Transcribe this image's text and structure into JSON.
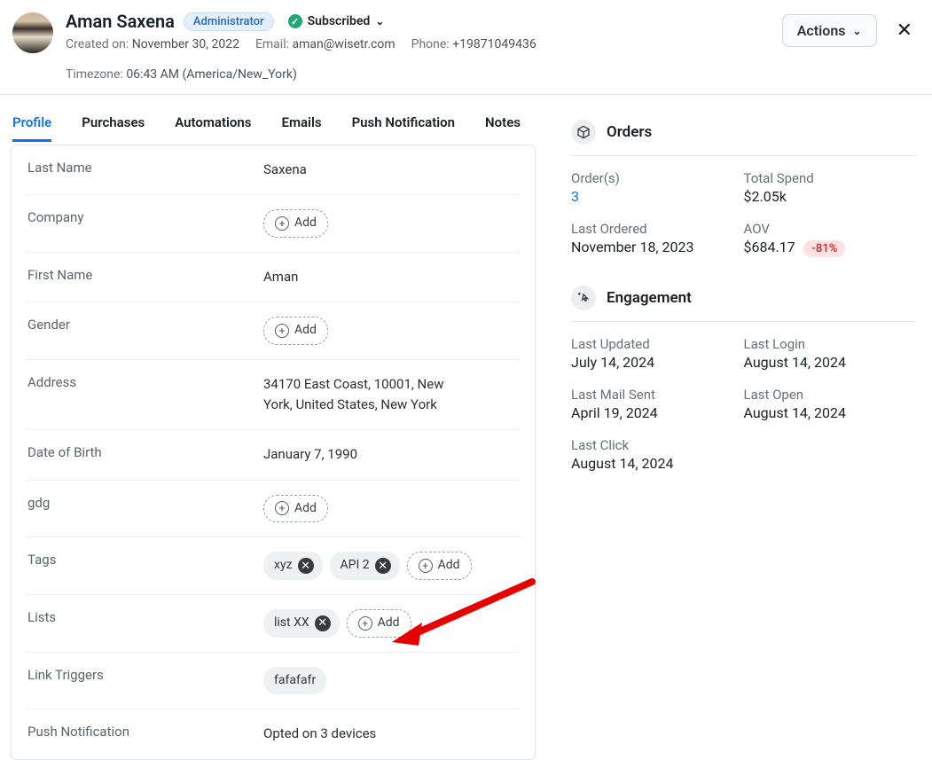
{
  "header": {
    "name": "Aman Saxena",
    "role_badge": "Administrator",
    "subscription": "Subscribed",
    "created_label": "Created on:",
    "created_value": "November 30, 2022",
    "email_label": "Email:",
    "email_value": "aman@wisetr.com",
    "phone_label": "Phone:",
    "phone_value": "+19871049436",
    "tz_label": "Timezone:",
    "tz_value": "06:43 AM (America/New_York)",
    "actions": "Actions"
  },
  "tabs": {
    "profile": "Profile",
    "purchases": "Purchases",
    "automations": "Automations",
    "emails": "Emails",
    "push": "Push Notification",
    "notes": "Notes"
  },
  "profile": {
    "last_name_label": "Last Name",
    "last_name_value": "Saxena",
    "company_label": "Company",
    "first_name_label": "First Name",
    "first_name_value": "Aman",
    "gender_label": "Gender",
    "address_label": "Address",
    "address_value": "34170 East Coast, 10001, New York, United States, New York",
    "dob_label": "Date of Birth",
    "dob_value": "January 7, 1990",
    "gdg_label": "gdg",
    "tags_label": "Tags",
    "tag1": "xyz",
    "tag2": "API 2",
    "lists_label": "Lists",
    "list1": "list XX",
    "link_triggers_label": "Link Triggers",
    "trigger1": "fafafafr",
    "push_label": "Push Notification",
    "push_value": "Opted on 3 devices",
    "add": "Add"
  },
  "orders": {
    "title": "Orders",
    "orders_label": "Order(s)",
    "orders_value": "3",
    "total_spend_label": "Total Spend",
    "total_spend_value": "$2.05k",
    "last_ordered_label": "Last Ordered",
    "last_ordered_value": "November 18, 2023",
    "aov_label": "AOV",
    "aov_value": "$684.17",
    "aov_delta": "-81%"
  },
  "engagement": {
    "title": "Engagement",
    "last_updated_label": "Last Updated",
    "last_updated_value": "July 14, 2024",
    "last_login_label": "Last Login",
    "last_login_value": "August 14, 2024",
    "last_mail_label": "Last Mail Sent",
    "last_mail_value": "April 19, 2024",
    "last_open_label": "Last Open",
    "last_open_value": "August 14, 2024",
    "last_click_label": "Last Click",
    "last_click_value": "August 14, 2024"
  }
}
